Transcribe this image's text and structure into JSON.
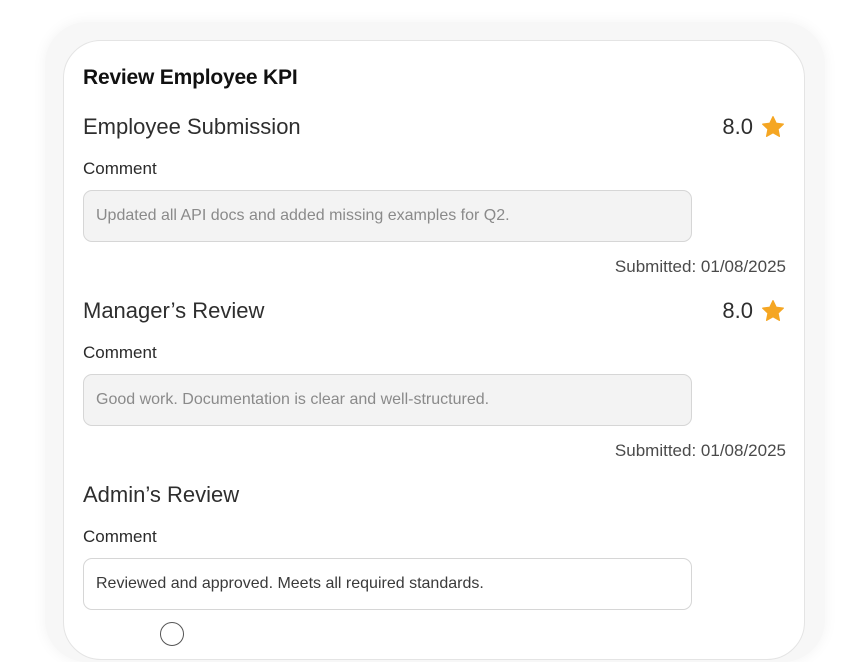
{
  "page": {
    "title": "Review Employee KPI"
  },
  "employee_submission": {
    "title": "Employee Submission",
    "rating": "8.0",
    "comment_label": "Comment",
    "comment_value": "Updated all API docs and added missing examples for Q2.",
    "submitted": "Submitted: 01/08/2025"
  },
  "manager_review": {
    "title": "Manager’s Review",
    "rating": "8.0",
    "comment_label": "Comment",
    "comment_value": "Good work. Documentation is clear and well-structured.",
    "submitted": "Submitted: 01/08/2025"
  },
  "admin_review": {
    "title": "Admin’s Review",
    "comment_label": "Comment",
    "comment_value": "Reviewed and approved. Meets all required standards."
  },
  "colors": {
    "star": "#F5A623",
    "card_border": "#E4E4E4",
    "readonly_bg": "#F3F3F3"
  },
  "icons": {
    "rating": "star-icon"
  }
}
